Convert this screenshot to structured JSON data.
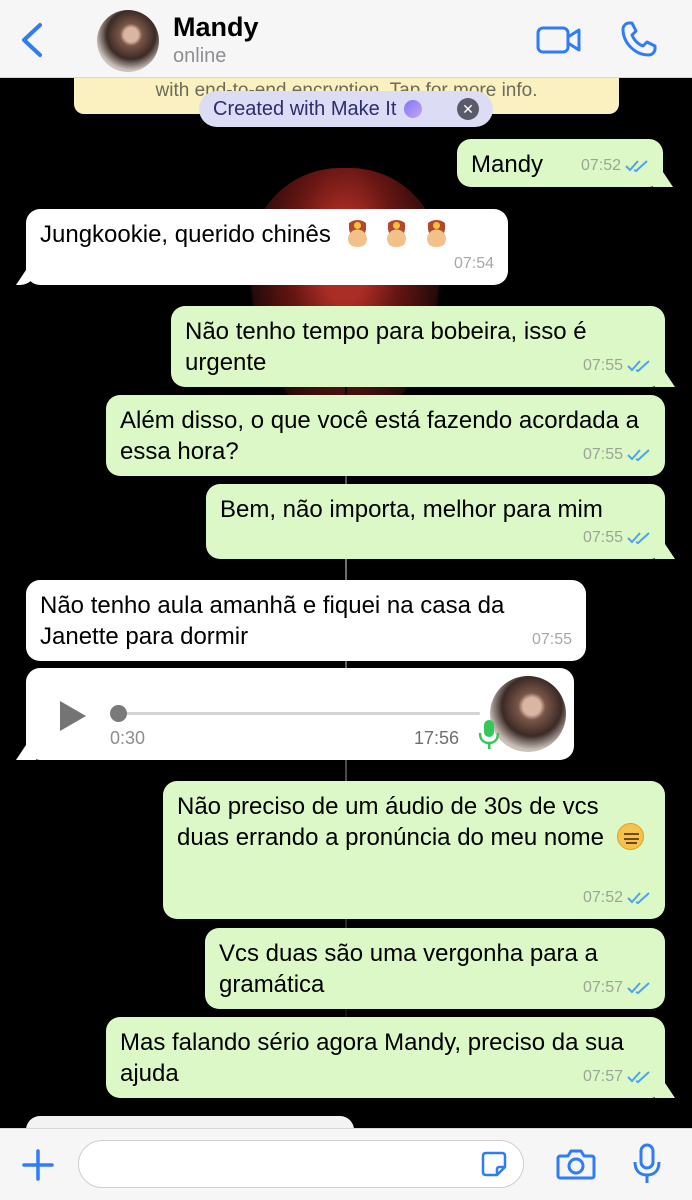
{
  "header": {
    "contact_name": "Mandy",
    "status": "online"
  },
  "banner": {
    "encryption_text": "with end-to-end encryption. Tap for more info.",
    "makeit_text": "Created with Make It"
  },
  "messages": [
    {
      "dir": "out",
      "text": "Mandy",
      "time": "07:52",
      "read": true
    },
    {
      "dir": "in",
      "text": "Jungkookie, querido chinês",
      "emoji": [
        "guard",
        "guard",
        "guard"
      ],
      "time": "07:54"
    },
    {
      "dir": "out",
      "text": "Não tenho tempo para bobeira, isso é urgente",
      "time": "07:55",
      "read": true
    },
    {
      "dir": "out",
      "text": "Além disso, o que você está fazendo acordada a essa hora?",
      "time": "07:55",
      "read": true
    },
    {
      "dir": "out",
      "text": "Bem, não importa, melhor para mim",
      "time": "07:55",
      "read": true
    },
    {
      "dir": "in",
      "text": "Não tenho aula amanhã e fiquei na casa da Janette para dormir",
      "time": "07:55"
    },
    {
      "dir": "in",
      "type": "voice",
      "duration": "0:30",
      "time": "17:56",
      "progress": 0
    },
    {
      "dir": "out",
      "text": "Não preciso de um áudio de 30s de vcs duas errando a pronúncia do meu nome",
      "emoji": [
        "neutral"
      ],
      "time": "07:52",
      "read": true
    },
    {
      "dir": "out",
      "text": "Vcs duas são uma vergonha para a gramática",
      "time": "07:57",
      "read": true
    },
    {
      "dir": "out",
      "text": "Mas falando sério agora Mandy, preciso da sua ajuda",
      "time": "07:57",
      "read": true
    }
  ],
  "input": {
    "placeholder": "",
    "value": ""
  },
  "colors": {
    "accent": "#2f7cf6",
    "outgoing_bubble": "#dcf8c6",
    "incoming_bubble": "#ffffff",
    "read_ticks": "#4fa3e8",
    "mic_green": "#35c759"
  }
}
